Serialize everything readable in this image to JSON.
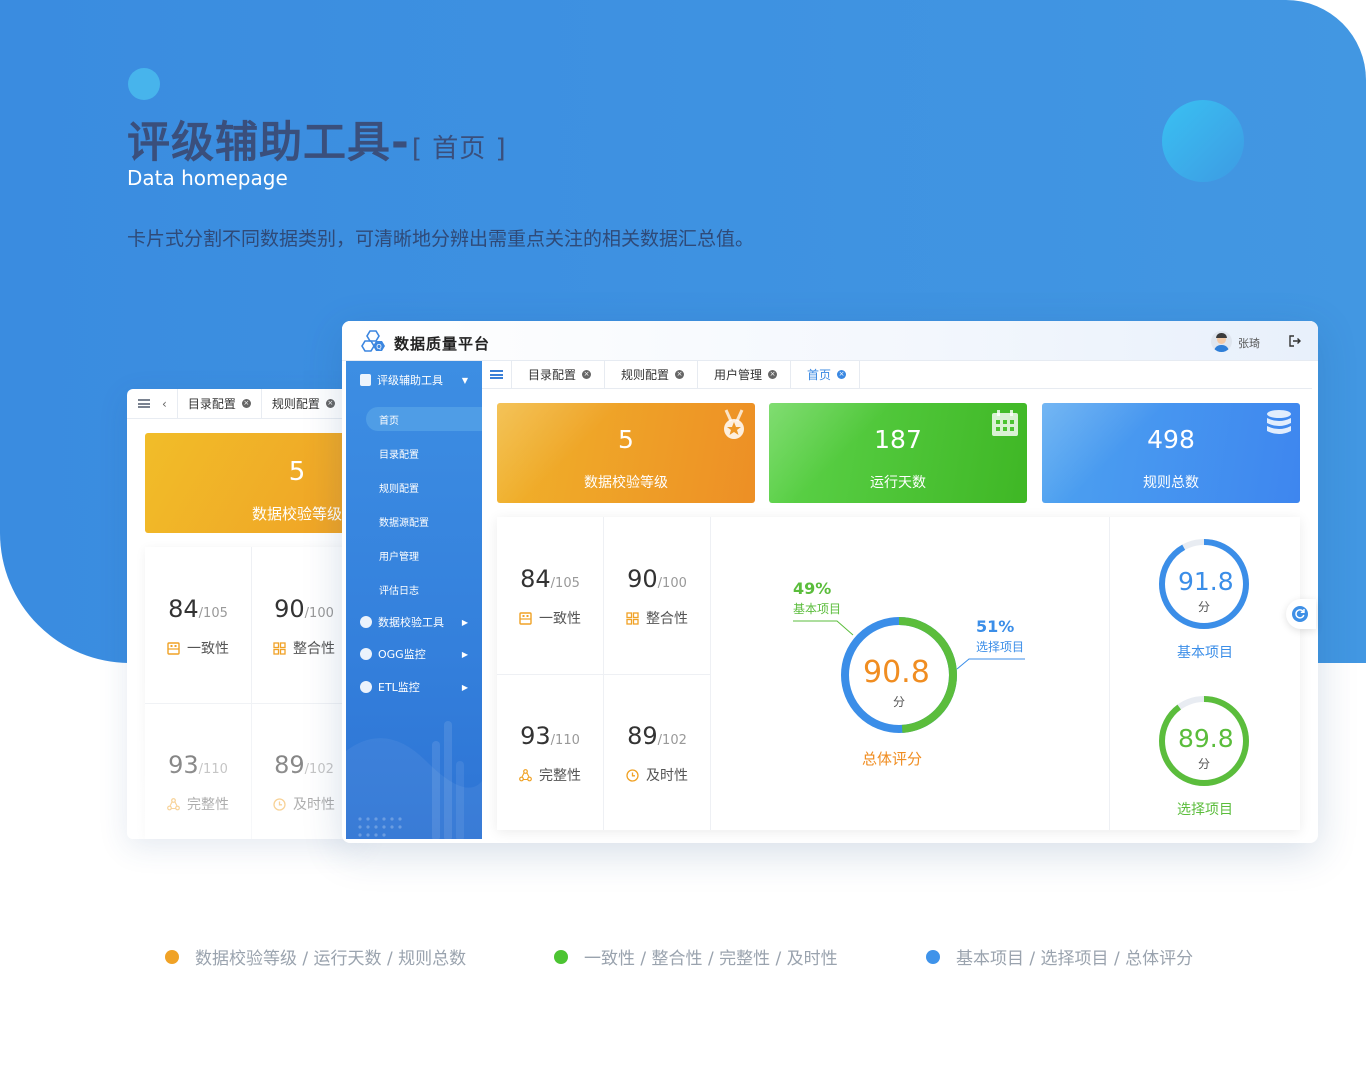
{
  "hero": {
    "title": "评级辅助工具-",
    "title_suffix": "[ 首页 ]",
    "subtitle_en": "Data homepage",
    "description": "卡片式分割不同数据类别，可清晰地分辨出需重点关注的相关数据汇总值。"
  },
  "back_window": {
    "tabs": [
      "目录配置",
      "规则配置"
    ],
    "card": {
      "value": "5",
      "label": "数据校验等级"
    },
    "stats": [
      {
        "value": "84",
        "total": "/105",
        "label": "一致性"
      },
      {
        "value": "90",
        "total": "/100",
        "label": "整合性"
      },
      {
        "value": "93",
        "total": "/110",
        "label": "完整性"
      },
      {
        "value": "89",
        "total": "/102",
        "label": "及时性"
      }
    ]
  },
  "app": {
    "title": "数据质量平台",
    "user_name": "张琦",
    "icons": {
      "logo": "hexagon-logo-icon",
      "logout": "logout-icon",
      "menu": "hamburger-icon"
    }
  },
  "sidebar": {
    "groups": [
      {
        "label": "评级辅助工具",
        "expanded": true
      },
      {
        "label": "数据校验工具"
      },
      {
        "label": "OGG监控"
      },
      {
        "label": "ETL监控"
      }
    ],
    "sub_items": [
      "首页",
      "目录配置",
      "规则配置",
      "数据源配置",
      "用户管理",
      "评估日志"
    ],
    "active_sub": "首页"
  },
  "tabs": [
    {
      "label": "目录配置"
    },
    {
      "label": "规则配置"
    },
    {
      "label": "用户管理"
    },
    {
      "label": "首页",
      "active": true
    }
  ],
  "kpis": [
    {
      "value": "5",
      "label": "数据校验等级",
      "icon": "medal-icon",
      "color": "#ed9a26"
    },
    {
      "value": "187",
      "label": "运行天数",
      "icon": "calendar-icon",
      "color": "#4cc432"
    },
    {
      "value": "498",
      "label": "规则总数",
      "icon": "database-icon",
      "color": "#4595ef"
    }
  ],
  "stats": [
    {
      "value": "84",
      "total": "/105",
      "label": "一致性",
      "icon": "consistency-icon"
    },
    {
      "value": "90",
      "total": "/100",
      "label": "整合性",
      "icon": "integration-icon"
    },
    {
      "value": "93",
      "total": "/110",
      "label": "完整性",
      "icon": "completeness-icon"
    },
    {
      "value": "89",
      "total": "/102",
      "label": "及时性",
      "icon": "clock-icon"
    }
  ],
  "overall": {
    "score": "90.8",
    "unit": "分",
    "label": "总体评分",
    "basic_pct": "49%",
    "basic_label": "基本项目",
    "optional_pct": "51%",
    "optional_label": "选择项目",
    "colors": {
      "basic": "#5bbd3c",
      "optional": "#3b8ee8",
      "score": "#f08d21"
    }
  },
  "side_scores": [
    {
      "score": "91.8",
      "unit": "分",
      "label": "基本项目",
      "fraction": 0.918,
      "color": "#3b8ee8"
    },
    {
      "score": "89.8",
      "unit": "分",
      "label": "选择项目",
      "fraction": 0.898,
      "color": "#5bbd3c"
    }
  ],
  "legend": [
    {
      "text": "数据校验等级 / 运行天数 / 规则总数",
      "color": "#f0a226"
    },
    {
      "text": "一致性 / 整合性 / 完整性 / 及时性",
      "color": "#4cc432"
    },
    {
      "text": "基本项目  / 选择项目 / 总体评分",
      "color": "#3f93ea"
    }
  ]
}
